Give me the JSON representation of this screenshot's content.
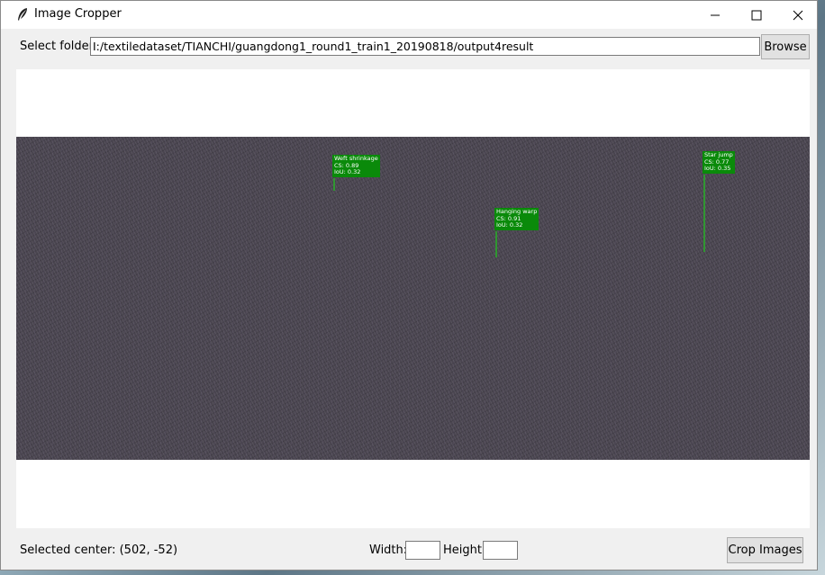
{
  "window": {
    "title": "Image Cropper",
    "app_icon": "feather-icon",
    "controls": [
      "minimize-icon",
      "maximize-icon",
      "close-icon"
    ]
  },
  "folder": {
    "label": "Select folder:",
    "path": "I:/textiledataset/TIANCHI/guangdong1_round1_train1_20190818/output4result",
    "browse_label": "Browse"
  },
  "detections": [
    {
      "lines": [
        "Weft shrinkage",
        "CS: 0.89",
        "IoU: 0.32"
      ]
    },
    {
      "lines": [
        "Hanging warp",
        "CS: 0.91",
        "IoU: 0.32"
      ]
    },
    {
      "lines": [
        "Star jump",
        "CS: 0.77",
        "IoU: 0.35"
      ]
    }
  ],
  "footer": {
    "status": "Selected center: (502, -52)",
    "width_label": "Width:",
    "width_value": "",
    "height_label": "Height:",
    "height_value": "",
    "crop_label": "Crop Images"
  },
  "colors": {
    "detection_box": "#0a8a0a",
    "fabric": "#4a4550"
  }
}
